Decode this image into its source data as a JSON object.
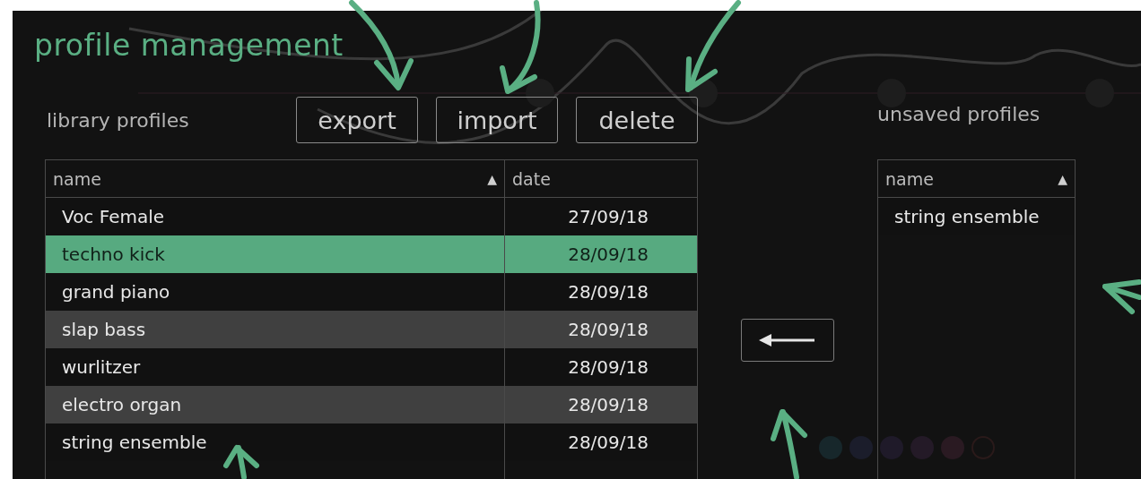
{
  "title": "profile management",
  "buttons": [
    "export",
    "import",
    "delete"
  ],
  "library": {
    "label": "library profiles",
    "columns": [
      {
        "label": "name",
        "sort_icon": "▲"
      },
      {
        "label": "date"
      }
    ],
    "rows": [
      {
        "name": "Voc Female",
        "date": "27/09/18",
        "selected": false
      },
      {
        "name": "techno kick",
        "date": "28/09/18",
        "selected": true
      },
      {
        "name": "grand piano",
        "date": "28/09/18",
        "selected": false
      },
      {
        "name": "slap bass",
        "date": "28/09/18",
        "selected": false
      },
      {
        "name": "wurlitzer",
        "date": "28/09/18",
        "selected": false
      },
      {
        "name": "electro organ",
        "date": "28/09/18",
        "selected": false
      },
      {
        "name": "string ensemble",
        "date": "28/09/18",
        "selected": false
      }
    ]
  },
  "unsaved": {
    "label": "unsaved profiles",
    "columns": [
      {
        "label": "name",
        "sort_icon": "▲"
      }
    ],
    "rows": [
      {
        "name": "string ensemble",
        "selected": false
      }
    ]
  }
}
